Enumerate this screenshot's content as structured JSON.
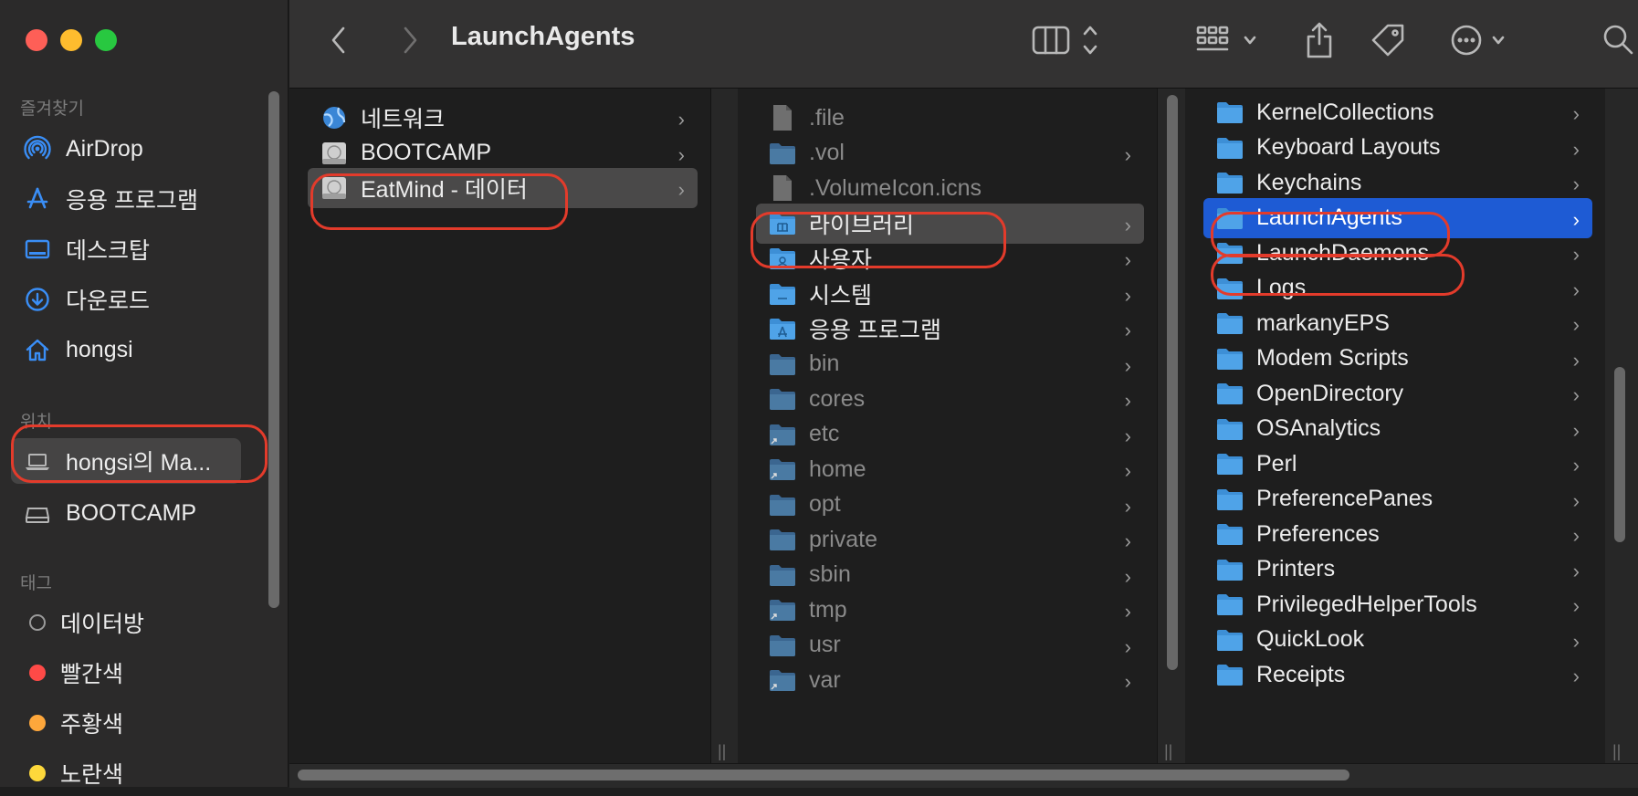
{
  "window": {
    "title": "LaunchAgents"
  },
  "sidebar": {
    "favorites_label": "즐겨찾기",
    "favorites": [
      {
        "label": "AirDrop",
        "icon": "airdrop-icon"
      },
      {
        "label": "응용 프로그램",
        "icon": "applications-icon"
      },
      {
        "label": "데스크탑",
        "icon": "desktop-icon"
      },
      {
        "label": "다운로드",
        "icon": "downloads-icon"
      },
      {
        "label": "hongsi",
        "icon": "home-icon"
      }
    ],
    "locations_label": "위치",
    "locations": [
      {
        "label": "hongsi의 Ma...",
        "icon": "laptop-icon",
        "selected": true
      },
      {
        "label": "BOOTCAMP",
        "icon": "disk-icon"
      }
    ],
    "tags_label": "태그",
    "tags": [
      {
        "label": "데이터방",
        "color": "#00000000"
      },
      {
        "label": "빨간색",
        "color": "#fe4a47"
      },
      {
        "label": "주황색",
        "color": "#fea73b"
      },
      {
        "label": "노란색",
        "color": "#fdd83b"
      }
    ]
  },
  "columns": {
    "col1": [
      {
        "label": "네트워크",
        "icon": "network-icon"
      },
      {
        "label": "BOOTCAMP",
        "icon": "disk-icon"
      },
      {
        "label": "EatMind - 데이터",
        "icon": "disk-icon",
        "selected": true
      }
    ],
    "col2": [
      {
        "label": ".file",
        "icon": "file-icon",
        "dim": true,
        "chevron": false
      },
      {
        "label": ".vol",
        "icon": "folder-icon",
        "dim": true
      },
      {
        "label": ".VolumeIcon.icns",
        "icon": "file-icon",
        "dim": true,
        "chevron": false
      },
      {
        "label": "라이브러리",
        "icon": "library-folder-icon",
        "selected": true
      },
      {
        "label": "사용자",
        "icon": "users-folder-icon"
      },
      {
        "label": "시스템",
        "icon": "system-folder-icon"
      },
      {
        "label": "응용 프로그램",
        "icon": "applications-folder-icon"
      },
      {
        "label": "bin",
        "icon": "folder-icon",
        "dim": true
      },
      {
        "label": "cores",
        "icon": "folder-icon",
        "dim": true
      },
      {
        "label": "etc",
        "icon": "alias-folder-icon",
        "dim": true
      },
      {
        "label": "home",
        "icon": "alias-folder-icon",
        "dim": true
      },
      {
        "label": "opt",
        "icon": "folder-icon",
        "dim": true
      },
      {
        "label": "private",
        "icon": "folder-icon",
        "dim": true
      },
      {
        "label": "sbin",
        "icon": "folder-icon",
        "dim": true
      },
      {
        "label": "tmp",
        "icon": "alias-folder-icon",
        "dim": true
      },
      {
        "label": "usr",
        "icon": "folder-icon",
        "dim": true
      },
      {
        "label": "var",
        "icon": "alias-folder-icon",
        "dim": true
      }
    ],
    "col3": [
      {
        "label": "KernelCollections",
        "icon": "folder-icon"
      },
      {
        "label": "Keyboard Layouts",
        "icon": "folder-icon"
      },
      {
        "label": "Keychains",
        "icon": "folder-icon"
      },
      {
        "label": "LaunchAgents",
        "icon": "folder-icon",
        "selected": true
      },
      {
        "label": "LaunchDaemons",
        "icon": "folder-icon"
      },
      {
        "label": "Logs",
        "icon": "folder-icon"
      },
      {
        "label": "markanyEPS",
        "icon": "folder-icon"
      },
      {
        "label": "Modem Scripts",
        "icon": "folder-icon"
      },
      {
        "label": "OpenDirectory",
        "icon": "folder-icon"
      },
      {
        "label": "OSAnalytics",
        "icon": "folder-icon"
      },
      {
        "label": "Perl",
        "icon": "folder-icon"
      },
      {
        "label": "PreferencePanes",
        "icon": "folder-icon"
      },
      {
        "label": "Preferences",
        "icon": "folder-icon"
      },
      {
        "label": "Printers",
        "icon": "folder-icon"
      },
      {
        "label": "PrivilegedHelperTools",
        "icon": "folder-icon"
      },
      {
        "label": "QuickLook",
        "icon": "folder-icon"
      },
      {
        "label": "Receipts",
        "icon": "folder-icon"
      }
    ]
  },
  "colors": {
    "accent": "#1e5bd4",
    "highlight": "#e33b2b",
    "folder": "#4fa3e8"
  }
}
